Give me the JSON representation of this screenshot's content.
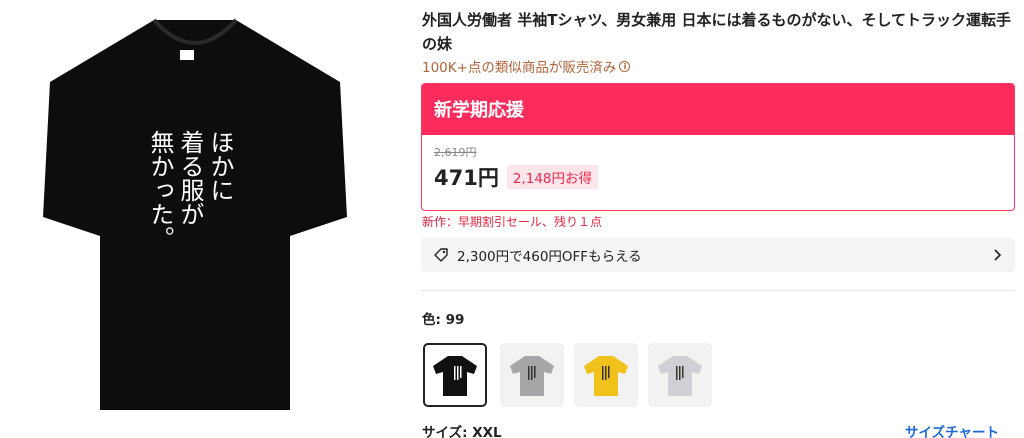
{
  "product": {
    "image_shirt_text": [
      "ほかに",
      "着る服が",
      "無かった。"
    ],
    "title": "外国人労働者 半袖Tシャツ、男女兼用 日本には着るものがない、そしてトラック運転手の妹",
    "sold_text": "100K+点の類似商品が販売済み"
  },
  "promo": {
    "header": "新学期応援",
    "original_price": "2,619円",
    "price": "471円",
    "discount_label": "2,148円お得"
  },
  "stock_note": "新作：早期割引セール、残り１点",
  "coupon": {
    "text": "2,300円で460円OFFもらえる"
  },
  "color": {
    "label": "色: 99",
    "swatches": [
      {
        "name": "black",
        "shirt_color": "#111111",
        "selected": true
      },
      {
        "name": "gray",
        "shirt_color": "#a6a6a8",
        "selected": false
      },
      {
        "name": "yellow",
        "shirt_color": "#f1c21c",
        "selected": false
      },
      {
        "name": "light-gray",
        "shirt_color": "#cfd0d4",
        "selected": false
      }
    ]
  },
  "size": {
    "label": "サイズ: XXL",
    "chart_link": "サイズチャート"
  },
  "colors": {
    "accent": "#fb2c5b",
    "link": "#1f6ad8",
    "sold": "#b0653b"
  }
}
